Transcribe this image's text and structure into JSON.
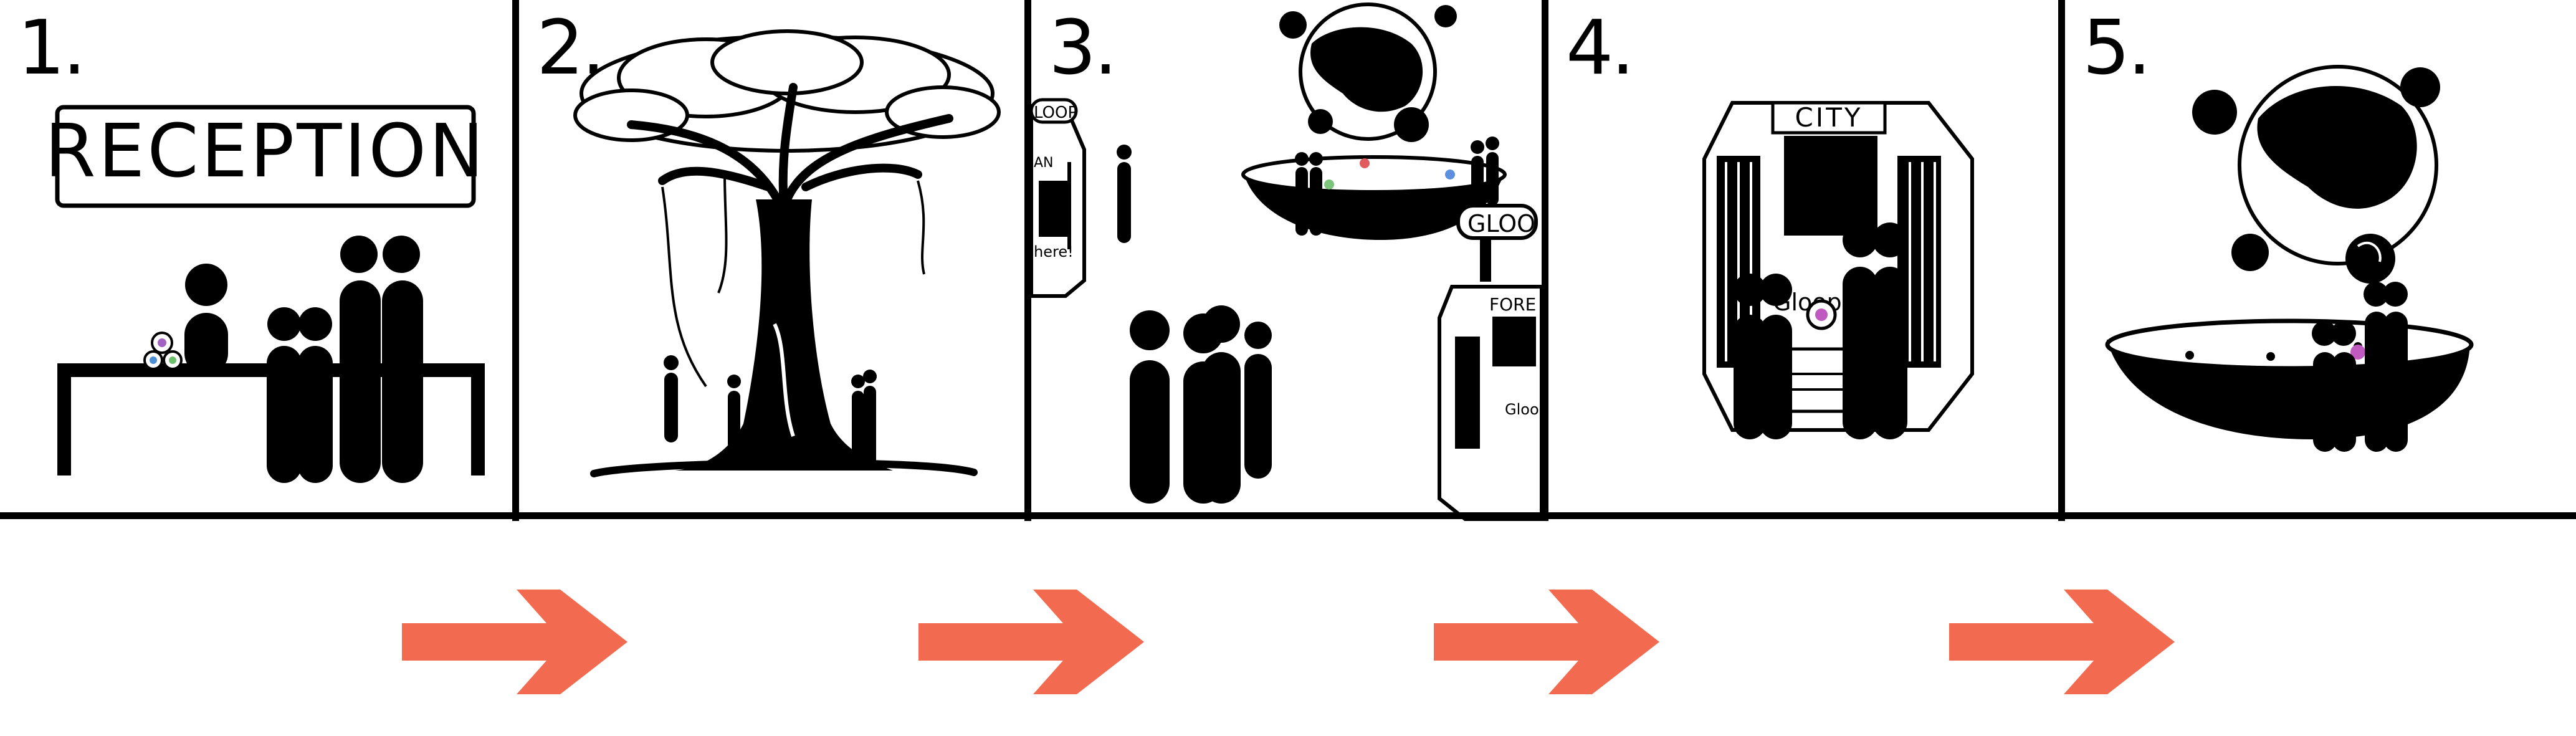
{
  "panels": [
    {
      "number": "1.",
      "sign": "RECEPTION"
    },
    {
      "number": "2."
    },
    {
      "number": "3.",
      "signs": [
        "LOOP",
        "AN",
        "here!",
        "GLOO",
        "FORE",
        "Gloop"
      ]
    },
    {
      "number": "4.",
      "signs": [
        "CITY",
        "Gloop h"
      ]
    },
    {
      "number": "5."
    }
  ],
  "colors": {
    "ink": "#000000",
    "arrow": "#f26a50",
    "background": "#ffffff"
  },
  "arrow_count": 4
}
